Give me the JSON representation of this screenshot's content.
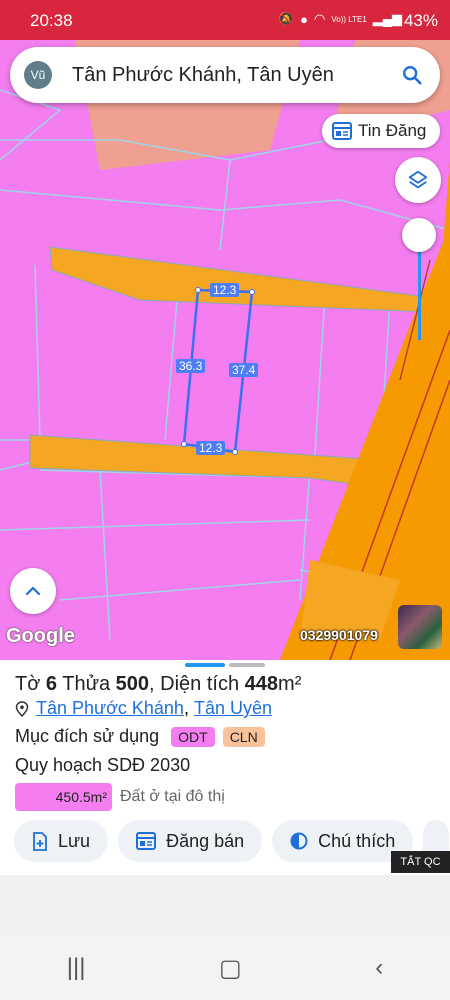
{
  "status_bar": {
    "time": "20:38",
    "network": "Vo)) LTE1",
    "battery": "43%"
  },
  "search": {
    "avatar_initials": "Vũ",
    "query": "Tân Phước Khánh, Tân Uyên",
    "icon": "search-icon"
  },
  "tin_dang_button": {
    "label": "Tin Đăng",
    "icon": "listing-icon"
  },
  "map": {
    "brand": "Google",
    "phone": "0329901079",
    "parcel_dimensions": {
      "top": "12.3",
      "left": "36.3",
      "right": "37.4",
      "bottom": "12.3"
    },
    "colors": {
      "residential": "#f47ef0",
      "road": "#f5a623",
      "road_major": "#f59a00",
      "other_land": "#f0a090"
    }
  },
  "parcel_info": {
    "sheet_label": "Tờ",
    "sheet_number": "6",
    "plot_label": "Thửa",
    "plot_number": "500",
    "area_label": "Diện tích",
    "area_value": "448",
    "area_unit": "m²",
    "location_ward": "Tân Phước Khánh",
    "location_separator": ", ",
    "location_district": "Tân Uyên",
    "usage_label": "Mục đích sử dụng",
    "usage_tags": [
      "ODT",
      "CLN"
    ],
    "planning_label": "Quy hoạch SDĐ 2030",
    "planning_area": "450.5m²",
    "planning_desc": "Đất ở tại đô thị"
  },
  "actions": [
    {
      "label": "Lưu",
      "icon": "save-add-icon"
    },
    {
      "label": "Đăng bán",
      "icon": "listing-icon"
    },
    {
      "label": "Chú thích",
      "icon": "legend-icon"
    }
  ],
  "ad_close_label": "TẮT QC"
}
